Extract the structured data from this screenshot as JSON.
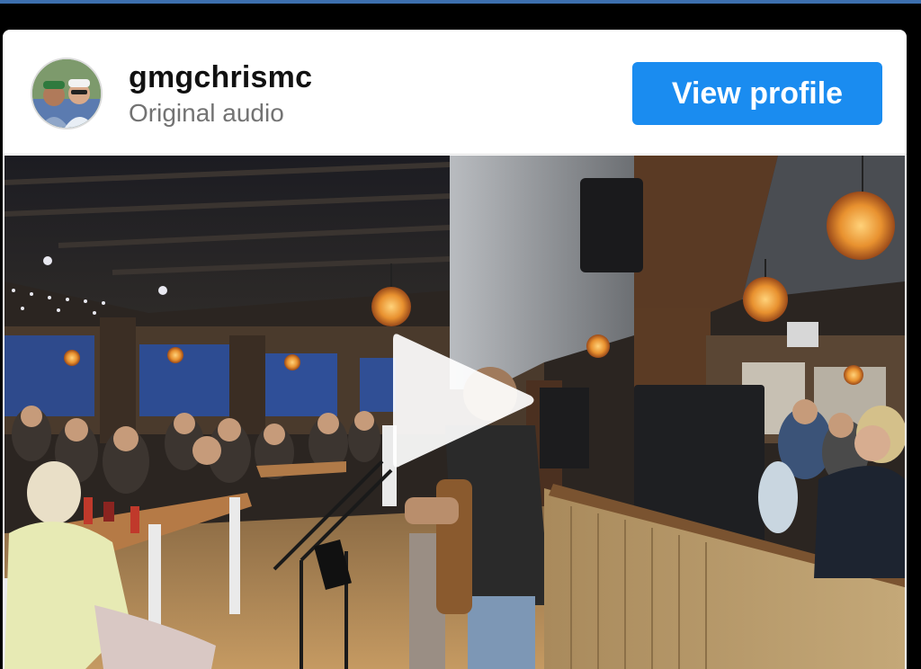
{
  "post": {
    "username": "gmgchrismc",
    "subtitle": "Original audio",
    "view_profile_label": "View profile"
  },
  "video": {
    "play_icon": "play-icon"
  },
  "colors": {
    "accent_blue": "#1a8cf0",
    "top_bar": "#3d6fae"
  }
}
